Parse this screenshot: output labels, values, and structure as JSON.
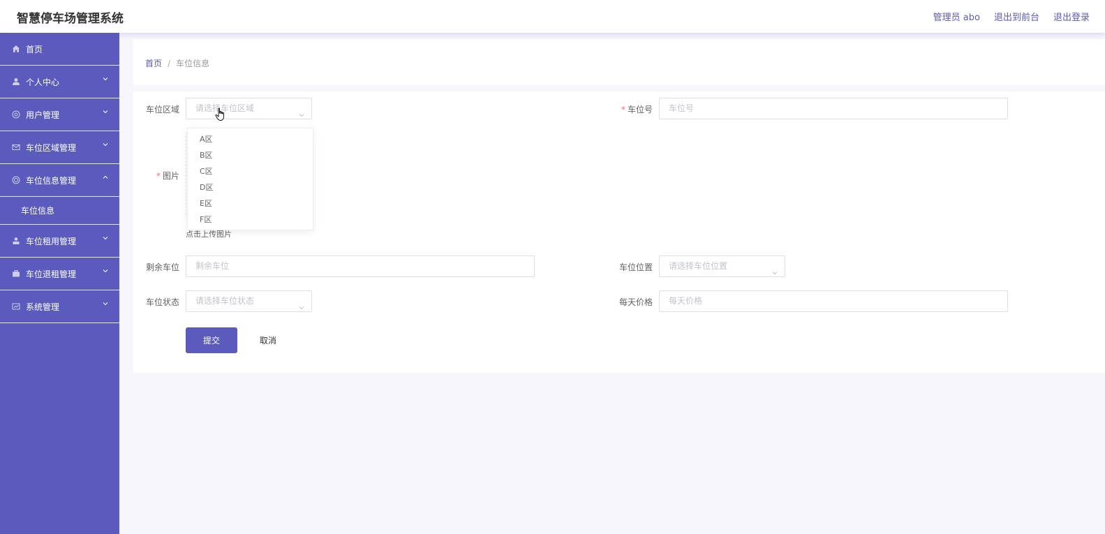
{
  "header": {
    "title": "智慧停车场管理系统",
    "admin_label": "管理员 abo",
    "to_frontend": "退出到前台",
    "logout": "退出登录"
  },
  "sidebar": {
    "items": [
      {
        "label": "首页",
        "icon": "home-icon"
      },
      {
        "label": "个人中心",
        "icon": "user-icon"
      },
      {
        "label": "用户管理",
        "icon": "help-icon"
      },
      {
        "label": "车位区域管理",
        "icon": "message-icon"
      },
      {
        "label": "车位信息管理",
        "icon": "lifebuoy-icon"
      },
      {
        "label": "车位租用管理",
        "icon": "user-solid-icon"
      },
      {
        "label": "车位退租管理",
        "icon": "briefcase-icon"
      },
      {
        "label": "系统管理",
        "icon": "chart-icon"
      }
    ],
    "submenu": {
      "label": "车位信息"
    }
  },
  "breadcrumb": {
    "home": "首页",
    "separator": "/",
    "current": "车位信息"
  },
  "form": {
    "area_label": "车位区域",
    "area_placeholder": "请选择车位区域",
    "number_label": "车位号",
    "number_placeholder": "车位号",
    "required_mark": "*",
    "image_label": "图片",
    "upload_hint": "点击上传图片",
    "remaining_label": "剩余车位",
    "remaining_placeholder": "剩余车位",
    "location_label": "车位位置",
    "location_placeholder": "请选择车位位置",
    "status_label": "车位状态",
    "status_placeholder": "请选择车位状态",
    "price_label": "每天价格",
    "price_placeholder": "每天价格",
    "submit": "提交",
    "cancel": "取消"
  },
  "dropdown": {
    "options": [
      "A区",
      "B区",
      "C区",
      "D区",
      "E区",
      "F区"
    ]
  },
  "colors": {
    "primary": "#5b5bbe",
    "required": "#f56c6c"
  }
}
